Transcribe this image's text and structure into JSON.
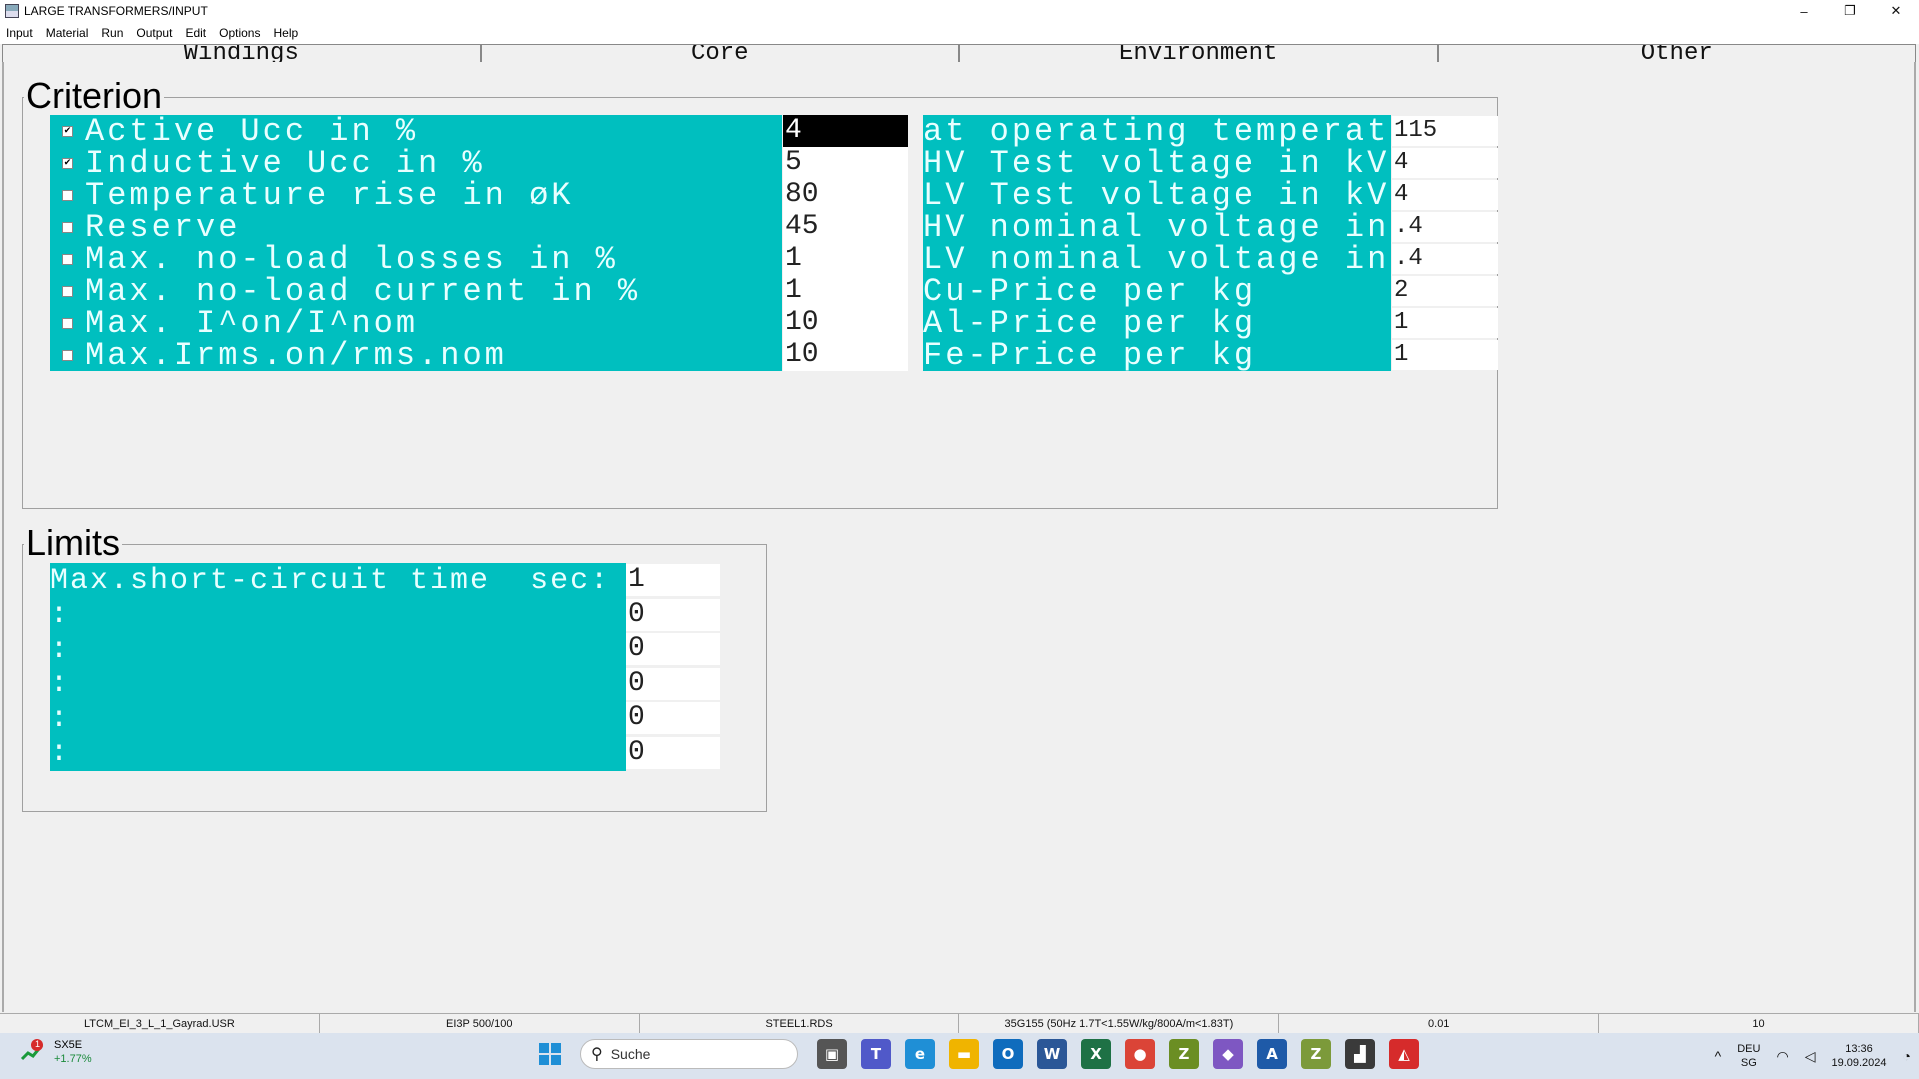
{
  "window": {
    "title": "LARGE TRANSFORMERS/INPUT",
    "minimize": "–",
    "maximize": "❐",
    "close": "✕"
  },
  "menu": [
    "Input",
    "Material",
    "Run",
    "Output",
    "Edit",
    "Options",
    "Help"
  ],
  "tabs": [
    "Windings",
    "Core",
    "Environment",
    "Other"
  ],
  "criterion": {
    "title": "Criterion",
    "rows": [
      {
        "label": "Active Ucc in %",
        "checked": true,
        "value": "4",
        "selected": true
      },
      {
        "label": "Inductive Ucc in %",
        "checked": true,
        "value": "5"
      },
      {
        "label": "Temperature rise in øK",
        "checked": false,
        "value": "80"
      },
      {
        "label": "Reserve",
        "checked": false,
        "value": "45"
      },
      {
        "label": "Max. no-load losses in %",
        "checked": false,
        "value": "1"
      },
      {
        "label": "Max. no-load current in %",
        "checked": false,
        "value": "1"
      },
      {
        "label": "Max. I^on/I^nom",
        "checked": false,
        "value": "10"
      },
      {
        "label": "Max.Irms.on/rms.nom",
        "checked": false,
        "value": "10"
      }
    ],
    "right_rows": [
      {
        "label": "at operating temperatur in",
        "value": "115"
      },
      {
        "label": "HV Test voltage in kV",
        "value": "4"
      },
      {
        "label": "LV Test voltage in kV",
        "value": "4"
      },
      {
        "label": "HV nominal voltage in kV",
        "value": ".4"
      },
      {
        "label": "LV nominal voltage in kV",
        "value": ".4"
      },
      {
        "label": "Cu-Price per kg",
        "value": "2"
      },
      {
        "label": "Al-Price per kg",
        "value": "1"
      },
      {
        "label": "Fe-Price per kg",
        "value": "1"
      }
    ]
  },
  "limits": {
    "title": "Limits",
    "rows": [
      {
        "label": "Max.short-circuit time  sec:",
        "value": "1"
      },
      {
        "label": ":",
        "value": "0"
      },
      {
        "label": ":",
        "value": "0"
      },
      {
        "label": ":",
        "value": "0"
      },
      {
        "label": ":",
        "value": "0"
      },
      {
        "label": ":",
        "value": "0"
      }
    ]
  },
  "status": [
    "LTCM_EI_3_L_1_Gayrad.USR",
    "EI3P 500/100",
    "STEEL1.RDS",
    "35G155 (50Hz 1.7T<1.55W/kg/800A/m<1.83T)",
    "0.01",
    "10"
  ],
  "taskbar": {
    "stock_badge": "1",
    "stock_name": "SX5E",
    "stock_change": "+1.77%",
    "search_placeholder": "Suche",
    "apps": [
      {
        "name": "task-view",
        "glyph": "▣",
        "color": "#555"
      },
      {
        "name": "teams",
        "glyph": "T",
        "color": "#5059c9"
      },
      {
        "name": "edge",
        "glyph": "e",
        "color": "#1f8fd6"
      },
      {
        "name": "file-explorer",
        "glyph": "▬",
        "color": "#f0b400"
      },
      {
        "name": "outlook",
        "glyph": "O",
        "color": "#0f6cbd"
      },
      {
        "name": "word",
        "glyph": "W",
        "color": "#2b5797"
      },
      {
        "name": "excel",
        "glyph": "X",
        "color": "#1e7145"
      },
      {
        "name": "chrome",
        "glyph": "●",
        "color": "#db4437"
      },
      {
        "name": "z-app",
        "glyph": "Z",
        "color": "#6b8e23"
      },
      {
        "name": "visual-studio",
        "glyph": "◆",
        "color": "#7e57c2"
      },
      {
        "name": "a-app",
        "glyph": "A",
        "color": "#1e5aa8"
      },
      {
        "name": "z-app-2",
        "glyph": "Z",
        "color": "#7c9a3a"
      },
      {
        "name": "transformers-app",
        "glyph": "▟",
        "color": "#3a3a3a"
      },
      {
        "name": "acrobat",
        "glyph": "◭",
        "color": "#d62b2b"
      }
    ],
    "lang_top": "DEU",
    "lang_bottom": "SG",
    "time": "13:36",
    "date": "19.09.2024"
  }
}
